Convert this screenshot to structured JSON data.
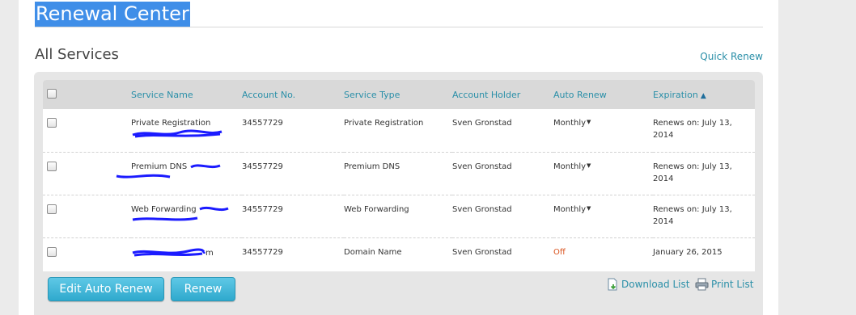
{
  "page": {
    "title": "Renewal Center",
    "section_title": "All Services",
    "quick_renew": "Quick Renew"
  },
  "colors": {
    "accent": "#2a8fa8",
    "button": "#3bb4d9",
    "off": "#d9531e",
    "title_highlight": "#3f8ee8"
  },
  "table": {
    "headers": [
      "Service Name",
      "Account No.",
      "Service Type",
      "Account Holder",
      "Auto Renew",
      "Expiration"
    ],
    "sort_indicator": "▲",
    "rows": [
      {
        "service_name": "Private Registration",
        "account_no": "34557729",
        "service_type": "Private Registration",
        "holder": "Sven Gronstad",
        "auto_renew": "Monthly",
        "auto_renew_caret": "▼",
        "expiration_l1": "Renews on: July 13,",
        "expiration_l2": "2014"
      },
      {
        "service_name": "Premium DNS",
        "account_no": "34557729",
        "service_type": "Premium DNS",
        "holder": "Sven Gronstad",
        "auto_renew": "Monthly",
        "auto_renew_caret": "▼",
        "expiration_l1": "Renews on: July 13,",
        "expiration_l2": "2014"
      },
      {
        "service_name": "Web Forwarding",
        "account_no": "34557729",
        "service_type": "Web Forwarding",
        "holder": "Sven Gronstad",
        "auto_renew": "Monthly",
        "auto_renew_caret": "▼",
        "expiration_l1": "Renews on: July 13,",
        "expiration_l2": "2014"
      },
      {
        "service_name": "m",
        "account_no": "34557729",
        "service_type": "Domain Name",
        "holder": "Sven Gronstad",
        "auto_renew": "Off",
        "expiration_l1": "January 26, 2015"
      }
    ]
  },
  "actions": {
    "edit_auto_renew": "Edit Auto Renew",
    "renew": "Renew",
    "download_list": "Download List",
    "print_list": "Print List"
  },
  "icons": {
    "download": "download-list-icon",
    "print": "printer-icon"
  }
}
